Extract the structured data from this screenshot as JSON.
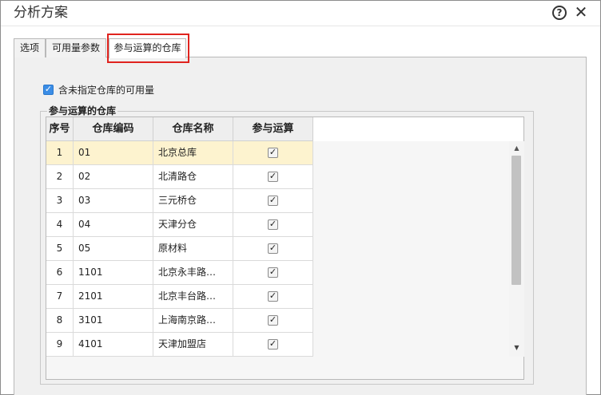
{
  "window": {
    "title": "分析方案",
    "help_icon": "question-circle-icon",
    "help_glyph": "?",
    "close_icon": "close-icon",
    "close_glyph": "✕"
  },
  "tabs": [
    {
      "label": "选项",
      "active": false
    },
    {
      "label": "可用量参数",
      "active": false
    },
    {
      "label": "参与运算的仓库",
      "active": true
    }
  ],
  "options": {
    "include_unassigned_label": "含未指定仓库的可用量",
    "include_unassigned_checked": true
  },
  "group": {
    "title": "参与运算的仓库"
  },
  "table": {
    "headers": [
      "序号",
      "仓库编码",
      "仓库名称",
      "参与运算"
    ],
    "rows": [
      {
        "no": "1",
        "code": "01",
        "name": "北京总库",
        "checked": true,
        "selected": true
      },
      {
        "no": "2",
        "code": "02",
        "name": "北清路仓",
        "checked": true,
        "selected": false
      },
      {
        "no": "3",
        "code": "03",
        "name": "三元桥仓",
        "checked": true,
        "selected": false
      },
      {
        "no": "4",
        "code": "04",
        "name": "天津分仓",
        "checked": true,
        "selected": false
      },
      {
        "no": "5",
        "code": "05",
        "name": "原材料",
        "checked": true,
        "selected": false
      },
      {
        "no": "6",
        "code": "1101",
        "name": "北京永丰路…",
        "checked": true,
        "selected": false
      },
      {
        "no": "7",
        "code": "2101",
        "name": "北京丰台路…",
        "checked": true,
        "selected": false
      },
      {
        "no": "8",
        "code": "3101",
        "name": "上海南京路…",
        "checked": true,
        "selected": false
      },
      {
        "no": "9",
        "code": "4101",
        "name": "天津加盟店",
        "checked": true,
        "selected": false
      }
    ]
  },
  "scrollbar": {
    "up_glyph": "▲",
    "down_glyph": "▼"
  },
  "colors": {
    "selected_row": "#fdf3cf",
    "tab_highlight": "#e0231e",
    "checkbox_checked": "#3b8de6"
  }
}
